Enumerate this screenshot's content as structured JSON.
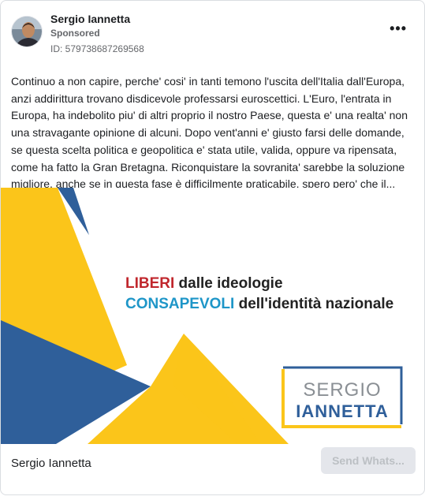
{
  "advertiser": {
    "name": "Sergio Iannetta",
    "sponsored_label": "Sponsored",
    "ad_id": "ID: 579738687269568"
  },
  "more_menu_label": "•••",
  "body_text": "Continuo a non capire, perche' cosi' in tanti temono l'uscita dell'Italia dall'Europa, anzi addirittura trovano disdicevole professarsi euroscettici. L'Euro, l'entrata in Europa, ha indebolito piu' di altri proprio il nostro Paese, questa e' una realta' non una stravagante opinione di alcuni. Dopo vent'anni e' giusto farsi delle domande, se questa scelta politica e geopolitica e' stata utile, valida, oppure va ripensata, come ha fatto la Gran Bretagna. Riconquistare la sovranita' sarebbe la soluzione migliore, anche se in questa fase è difficilmente praticabile, spero pero' che il...",
  "creative": {
    "line1_accent": "LIBERI",
    "line1_rest": " dalle ideologie",
    "line2_accent": "CONSAPEVOLI",
    "line2_rest": " dell'identità nazionale",
    "logo_line1": "SERGIO",
    "logo_line2": "IANNETTA",
    "colors": {
      "red": "#c0272d",
      "cyan": "#1e96c8",
      "yellow": "#fbc51a",
      "blue": "#2f5f9a",
      "dark": "#222222"
    }
  },
  "footer": {
    "page_name": "Sergio Iannetta",
    "cta_label": "Send Whats..."
  }
}
